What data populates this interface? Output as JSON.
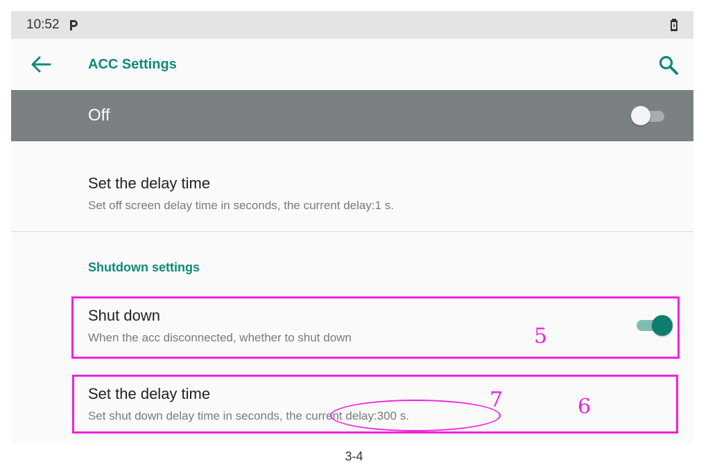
{
  "status_bar": {
    "time": "10:52"
  },
  "app_bar": {
    "title": "ACC Settings"
  },
  "master_switch": {
    "label": "Off",
    "state": "off"
  },
  "screen_delay": {
    "title": "Set the delay time",
    "summary": "Set off screen delay time in seconds, the current delay:1 s."
  },
  "shutdown": {
    "category": "Shutdown settings",
    "shut_down": {
      "title": "Shut down",
      "summary": "When the acc disconnected, whether to shut down",
      "state": "on"
    },
    "delay": {
      "title": "Set the delay time",
      "summary": "Set shut down delay time in seconds, the current delay:300 s."
    }
  },
  "annotations": {
    "box_5": "5",
    "box_6": "6",
    "ellipse_7": "7"
  },
  "caption": "3-4",
  "colors": {
    "accent": "#0d8a78",
    "master_bar": "#7b8083",
    "annotation": "#ee22dd"
  },
  "icons": {
    "back": "arrow-left-icon",
    "search": "search-icon",
    "battery": "battery-icon",
    "notification": "p-icon"
  }
}
